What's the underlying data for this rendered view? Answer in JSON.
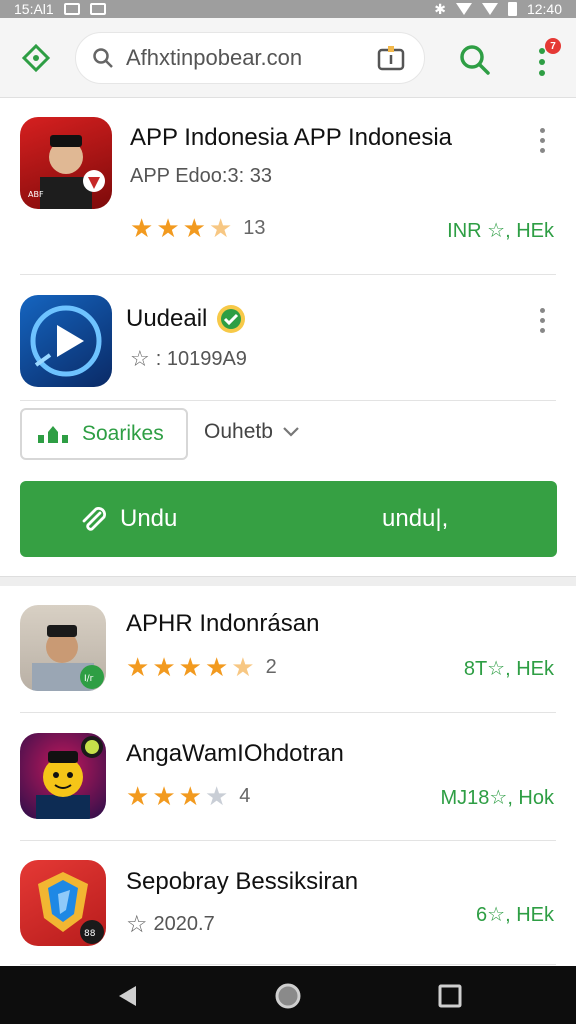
{
  "status_bar": {
    "time_left": "15:Al1",
    "time_right": "12:40"
  },
  "browser": {
    "url": "Afhxtinpobear.con",
    "menu_badge": "7"
  },
  "featured_app": {
    "title": "APP Indonesia APP Indonesia",
    "subtitle": "APP Edoo:3: 33",
    "rating": 3.5,
    "rating_count": "13",
    "price": "INR ☆, HEk"
  },
  "detail_app": {
    "title": "Uudeail",
    "downloads": ": 10199A9",
    "sources_label": "Soarikes",
    "dropdown_label": "Ouhetb",
    "install_left": "Undu",
    "install_right": "undu|,"
  },
  "app_list": [
    {
      "title": "APHR Indonrásan",
      "rating": 4.5,
      "count": "2",
      "price": "8T☆, HEk"
    },
    {
      "title": "AngaWamIOhdotran",
      "rating": 3.5,
      "count": "4",
      "price": "MJ18☆, Hok"
    },
    {
      "title": "Sepobray Bessiksiran",
      "rating": 0,
      "count": "2020.7",
      "price": "6☆, HEk"
    }
  ],
  "colors": {
    "accent_green": "#36a043",
    "star": "#f29a1f"
  }
}
